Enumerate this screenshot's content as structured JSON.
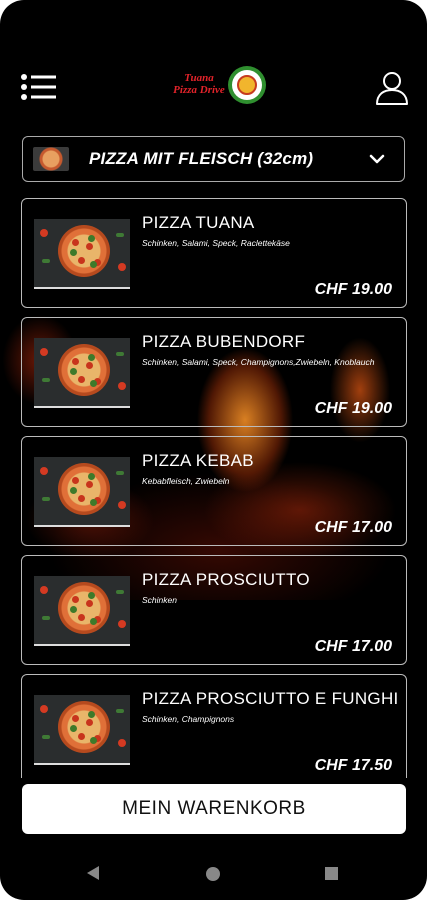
{
  "header": {
    "logo_text_line1": "Tuana",
    "logo_text_line2": "Pizza Drive",
    "menu_icon": "hamburger-menu-icon",
    "user_icon": "user-icon"
  },
  "category": {
    "label": "PIZZA MIT FLEISCH (32cm)",
    "icon": "chevron-down-icon"
  },
  "items": [
    {
      "name": "PIZZA TUANA",
      "description": "Schinken, Salami, Speck, Raclettekäse",
      "price": "CHF 19.00"
    },
    {
      "name": "PIZZA BUBENDORF",
      "description": "Schinken, Salami, Speck, Champignons,Zwiebeln, Knoblauch",
      "price": "CHF 19.00"
    },
    {
      "name": "PIZZA KEBAB",
      "description": "Kebabfleisch, Zwiebeln",
      "price": "CHF 17.00"
    },
    {
      "name": "PIZZA PROSCIUTTO",
      "description": "Schinken",
      "price": "CHF 17.00"
    },
    {
      "name": "PIZZA PROSCIUTTO E FUNGHI",
      "description": "Schinken, Champignons",
      "price": "CHF 17.50"
    }
  ],
  "cart": {
    "label": "MEIN WARENKORB"
  },
  "navbar": {
    "back": "back-icon",
    "home": "home-icon",
    "recents": "recents-icon"
  }
}
